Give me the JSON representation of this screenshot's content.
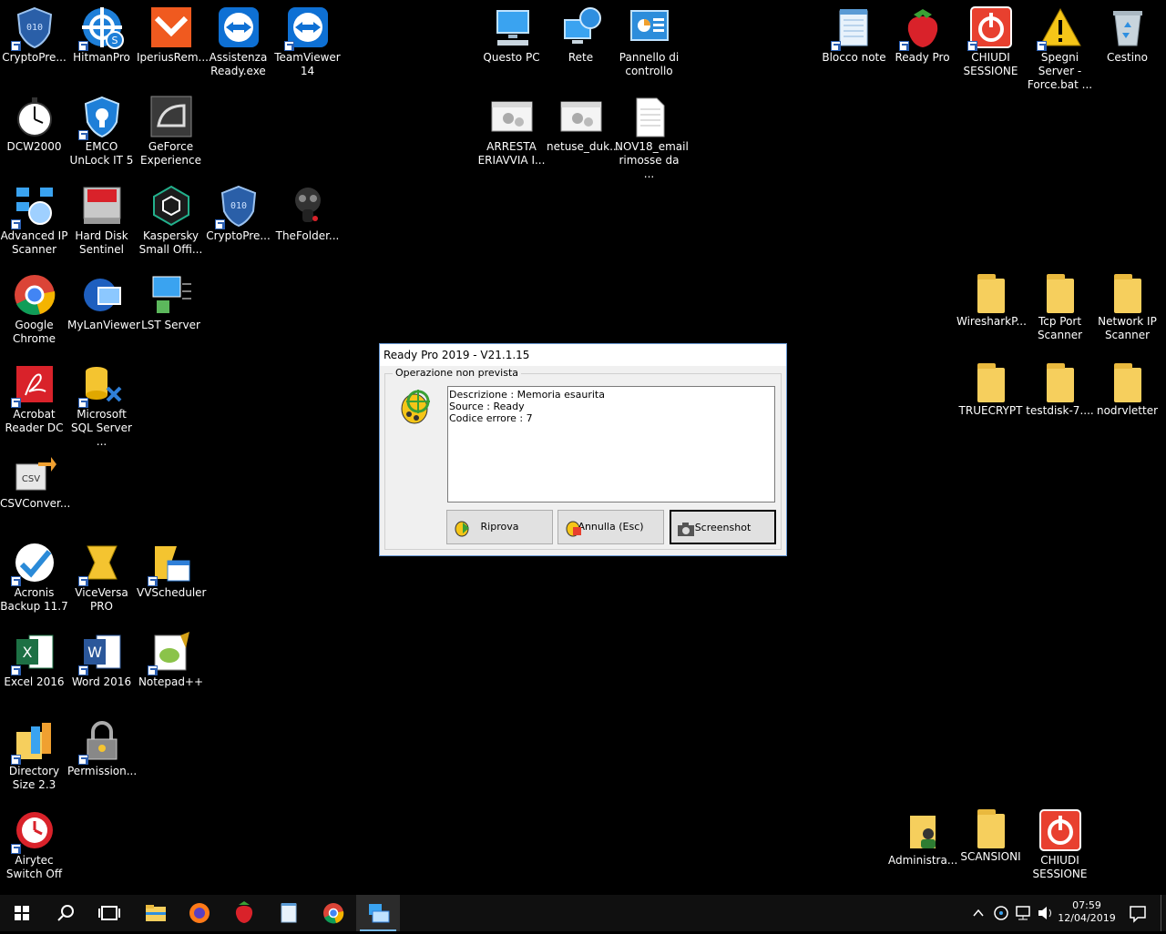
{
  "desktop": {
    "icons": [
      {
        "id": "cryptoprevent1",
        "label": "CryptoPre..."
      },
      {
        "id": "hitmanpro",
        "label": "HitmanPro"
      },
      {
        "id": "iperius",
        "label": "IperiusRem..."
      },
      {
        "id": "assistenza",
        "label": "Assistenza Ready.exe"
      },
      {
        "id": "teamviewer",
        "label": "TeamViewer 14"
      },
      {
        "id": "questopc",
        "label": "Questo PC"
      },
      {
        "id": "rete",
        "label": "Rete"
      },
      {
        "id": "pannello",
        "label": "Pannello di controllo"
      },
      {
        "id": "blocconote",
        "label": "Blocco note"
      },
      {
        "id": "readypro",
        "label": "Ready Pro"
      },
      {
        "id": "chiudi1",
        "label": "CHIUDI SESSIONE"
      },
      {
        "id": "spegni",
        "label": "Spegni Server - Force.bat ..."
      },
      {
        "id": "cestino",
        "label": "Cestino"
      },
      {
        "id": "dcw2000",
        "label": "DCW2000"
      },
      {
        "id": "emco",
        "label": "EMCO UnLock IT 5"
      },
      {
        "id": "geforce",
        "label": "GeForce Experience"
      },
      {
        "id": "arresta",
        "label": "ARRESTA ERIAVVIA I..."
      },
      {
        "id": "netuse",
        "label": "netuse_duk..."
      },
      {
        "id": "nov18",
        "label": "NOV18_email rimosse da ..."
      },
      {
        "id": "advip",
        "label": "Advanced IP Scanner"
      },
      {
        "id": "hdsentinel",
        "label": "Hard Disk Sentinel"
      },
      {
        "id": "kaspersky",
        "label": "Kaspersky Small Offi..."
      },
      {
        "id": "cryptoprevent2",
        "label": "CryptoPre..."
      },
      {
        "id": "thefolder",
        "label": "TheFolder..."
      },
      {
        "id": "chrome",
        "label": "Google Chrome"
      },
      {
        "id": "mylanviewer",
        "label": "MyLanViewer"
      },
      {
        "id": "lstserver",
        "label": "LST Server"
      },
      {
        "id": "wireshark",
        "label": "WiresharkP..."
      },
      {
        "id": "tcpport",
        "label": "Tcp Port Scanner"
      },
      {
        "id": "networkip",
        "label": "Network IP Scanner"
      },
      {
        "id": "acrobat",
        "label": "Acrobat Reader DC"
      },
      {
        "id": "mssql",
        "label": "Microsoft SQL Server ..."
      },
      {
        "id": "truecrypt",
        "label": "TRUECRYPT"
      },
      {
        "id": "testdisk",
        "label": "testdisk-7...."
      },
      {
        "id": "nodrv",
        "label": "nodrvletter"
      },
      {
        "id": "csvconv",
        "label": "CSVConver..."
      },
      {
        "id": "acronis",
        "label": "Acronis Backup 11.7"
      },
      {
        "id": "viceversa",
        "label": "ViceVersa PRO"
      },
      {
        "id": "vvscheduler",
        "label": "VVScheduler"
      },
      {
        "id": "excel",
        "label": "Excel 2016"
      },
      {
        "id": "word",
        "label": "Word 2016"
      },
      {
        "id": "notepadpp",
        "label": "Notepad++"
      },
      {
        "id": "dirsize",
        "label": "Directory Size 2.3"
      },
      {
        "id": "permission",
        "label": "Permission..."
      },
      {
        "id": "airytec",
        "label": "Airytec Switch Off"
      },
      {
        "id": "administra",
        "label": "Administra..."
      },
      {
        "id": "scansioni",
        "label": "SCANSIONI"
      },
      {
        "id": "chiudi2",
        "label": "CHIUDI SESSIONE"
      }
    ]
  },
  "dialog": {
    "title": "Ready Pro 2019 - V21.1.15",
    "group_label": "Operazione non prevista",
    "message_lines": [
      "Descrizione : Memoria esaurita",
      "Source : Ready",
      "Codice errore : 7"
    ],
    "buttons": {
      "retry": "Riprova",
      "cancel": "Annulla (Esc)",
      "screenshot": "Screenshot"
    }
  },
  "taskbar": {
    "time": "07:59",
    "date": "12/04/2019"
  },
  "colors": {
    "accent": "#76b9ed",
    "chiudi_red": "#e8402f",
    "folder_yellow": "#f6cf5d"
  }
}
